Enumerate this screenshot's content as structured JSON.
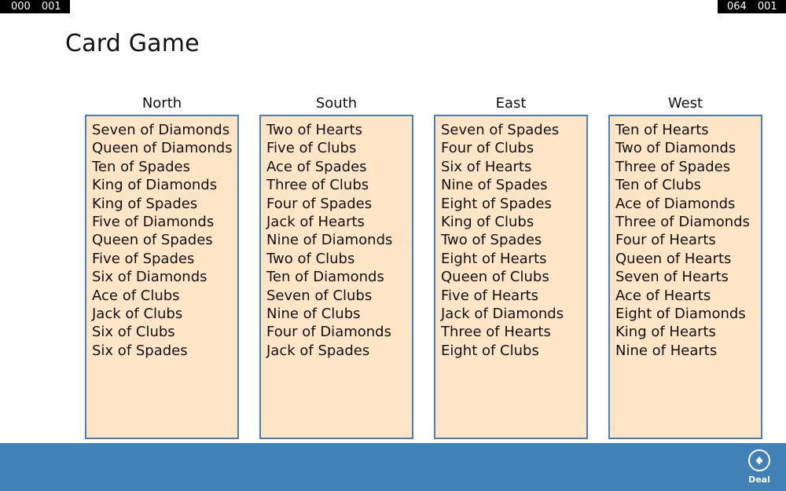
{
  "counters": {
    "left": [
      "000",
      "001"
    ],
    "right": [
      "064",
      "001"
    ]
  },
  "page": {
    "title": "Card Game"
  },
  "hands": [
    {
      "name": "North",
      "cards": [
        "Seven of Diamonds",
        "Queen of Diamonds",
        "Ten of Spades",
        "King of Diamonds",
        "King of Spades",
        "Five of Diamonds",
        "Queen of Spades",
        "Five of Spades",
        "Six of Diamonds",
        "Ace of Clubs",
        "Jack of Clubs",
        "Six of Clubs",
        "Six of Spades"
      ]
    },
    {
      "name": "South",
      "cards": [
        "Two of Hearts",
        "Five of Clubs",
        "Ace of Spades",
        "Three of Clubs",
        "Four of Spades",
        "Jack of Hearts",
        "Nine of Diamonds",
        "Two of Clubs",
        "Ten of Diamonds",
        "Seven of Clubs",
        "Nine of Clubs",
        "Four of Diamonds",
        "Jack of Spades"
      ]
    },
    {
      "name": "East",
      "cards": [
        "Seven of Spades",
        "Four of Clubs",
        "Six of Hearts",
        "Nine of Spades",
        "Eight of Spades",
        "King of Clubs",
        "Two of Spades",
        "Eight of Hearts",
        "Queen of Clubs",
        "Five of Hearts",
        "Jack of Diamonds",
        "Three of Hearts",
        "Eight of Clubs"
      ]
    },
    {
      "name": "West",
      "cards": [
        "Ten of Hearts",
        "Two of Diamonds",
        "Three of Spades",
        "Ten of Clubs",
        "Ace of Diamonds",
        "Three of Diamonds",
        "Four of Hearts",
        "Queen of Hearts",
        "Seven of Hearts",
        "Ace of Hearts",
        "Eight of Diamonds",
        "King of Hearts",
        "Nine of Hearts"
      ]
    }
  ],
  "appbar": {
    "deal_label": "Deal",
    "deal_icon": "spade-icon"
  },
  "colors": {
    "appbar": "#4281b6",
    "list_background": "#fee5c6",
    "list_border": "#4a80b6"
  }
}
